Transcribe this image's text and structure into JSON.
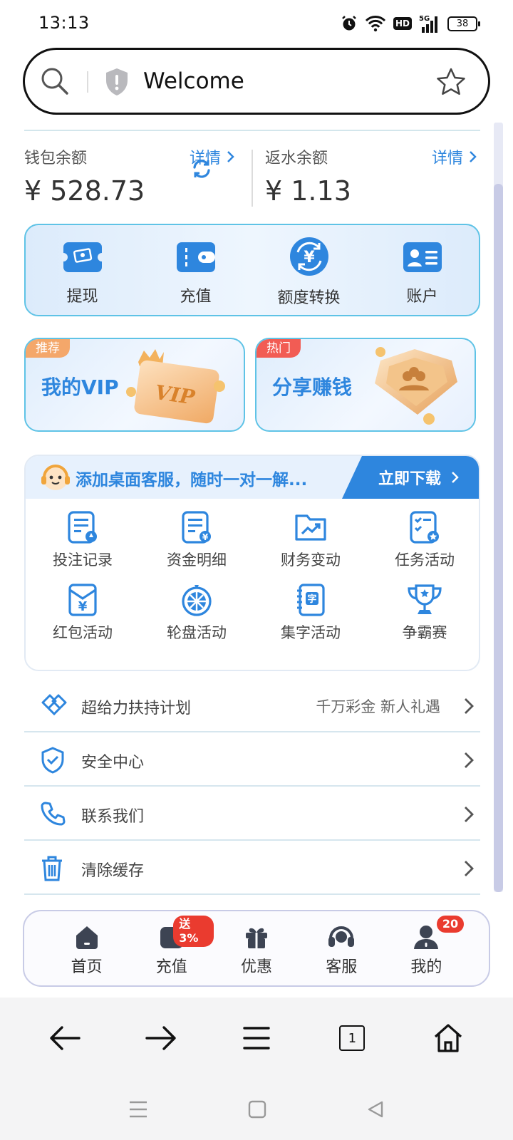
{
  "status_bar": {
    "time": "13:13",
    "hd": "HD",
    "network": "5G",
    "battery": "38"
  },
  "browser": {
    "address_text": "Welcome",
    "tab_count": "1"
  },
  "wallet": {
    "label": "钱包余额",
    "detail": "详情",
    "value": "¥ 528.73"
  },
  "rebate": {
    "label": "返水余额",
    "detail": "详情",
    "value": "¥ 1.13"
  },
  "quick_actions": [
    {
      "label": "提现",
      "icon": "cash-withdraw-icon"
    },
    {
      "label": "充值",
      "icon": "wallet-icon"
    },
    {
      "label": "额度转换",
      "icon": "yuan-exchange-icon"
    },
    {
      "label": "账户",
      "icon": "account-card-icon"
    }
  ],
  "promos": [
    {
      "tag": "推荐",
      "title": "我的VIP",
      "art": "vip-card-art"
    },
    {
      "tag": "热门",
      "title": "分享赚钱",
      "art": "share-badge-art"
    }
  ],
  "banner": {
    "text": "添加桌面客服，随时一对一解...",
    "button": "立即下载"
  },
  "grid_items": [
    {
      "label": "投注记录",
      "icon": "bet-record-icon"
    },
    {
      "label": "资金明细",
      "icon": "fund-detail-icon"
    },
    {
      "label": "财务变动",
      "icon": "finance-change-icon"
    },
    {
      "label": "任务活动",
      "icon": "task-icon"
    },
    {
      "label": "红包活动",
      "icon": "red-envelope-icon"
    },
    {
      "label": "轮盘活动",
      "icon": "roulette-icon"
    },
    {
      "label": "集字活动",
      "icon": "word-collect-icon"
    },
    {
      "label": "争霸赛",
      "icon": "trophy-icon"
    }
  ],
  "list_rows": [
    {
      "label": "超给力扶持计划",
      "right": "千万彩金 新人礼遇",
      "icon": "handshake-icon"
    },
    {
      "label": "安全中心",
      "right": "",
      "icon": "shield-check-icon"
    },
    {
      "label": "联系我们",
      "right": "",
      "icon": "phone-icon"
    },
    {
      "label": "清除缓存",
      "right": "",
      "icon": "trash-icon"
    }
  ],
  "tabs": [
    {
      "label": "首页",
      "icon": "home-icon",
      "badge": ""
    },
    {
      "label": "充值",
      "icon": "wallet-icon",
      "badge": "送3%"
    },
    {
      "label": "优惠",
      "icon": "gift-icon",
      "badge": ""
    },
    {
      "label": "客服",
      "icon": "headset-icon",
      "badge": ""
    },
    {
      "label": "我的",
      "icon": "user-icon",
      "badge": "20"
    }
  ],
  "colors": {
    "accent": "#2e86de",
    "badge_red": "#ea3b2f",
    "tag_orange": "#f4a76a",
    "tag_red": "#f25c54"
  }
}
